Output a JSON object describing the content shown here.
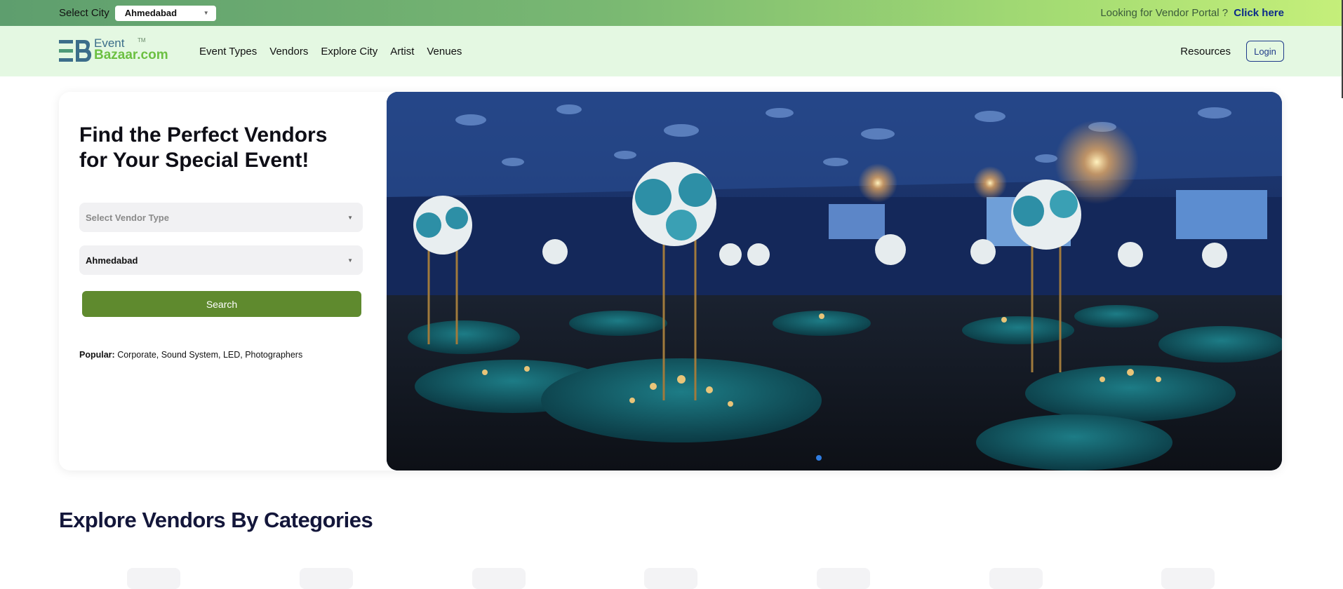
{
  "topbar": {
    "city_label": "Select City",
    "city_value": "Ahmedabad",
    "portal_text": "Looking for Vendor Portal ?",
    "portal_link": "Click here"
  },
  "nav": {
    "logo_event": "Event",
    "logo_bazaar": "Bazaar.com",
    "logo_tm": "TM",
    "links": [
      "Event Types",
      "Vendors",
      "Explore City",
      "Artist",
      "Venues"
    ],
    "resources": "Resources",
    "login": "Login"
  },
  "hero": {
    "title": "Find the Perfect Vendors for Your Special Event!",
    "vendor_type_placeholder": "Select Vendor Type",
    "city_value": "Ahmedabad",
    "search_label": "Search",
    "popular_label": "Popular:",
    "popular_items": "Corporate, Sound System, LED, Photographers"
  },
  "categories": {
    "title": "Explore Vendors By Categories"
  },
  "colors": {
    "topbar_start": "#5e9e6e",
    "topbar_end": "#c5ef7a",
    "nav_bg": "#e4f8e2",
    "search_button": "#5f8a2e",
    "login_border": "#1f3b8a",
    "heading": "#13163a",
    "carousel_dot": "#2f7de1"
  }
}
